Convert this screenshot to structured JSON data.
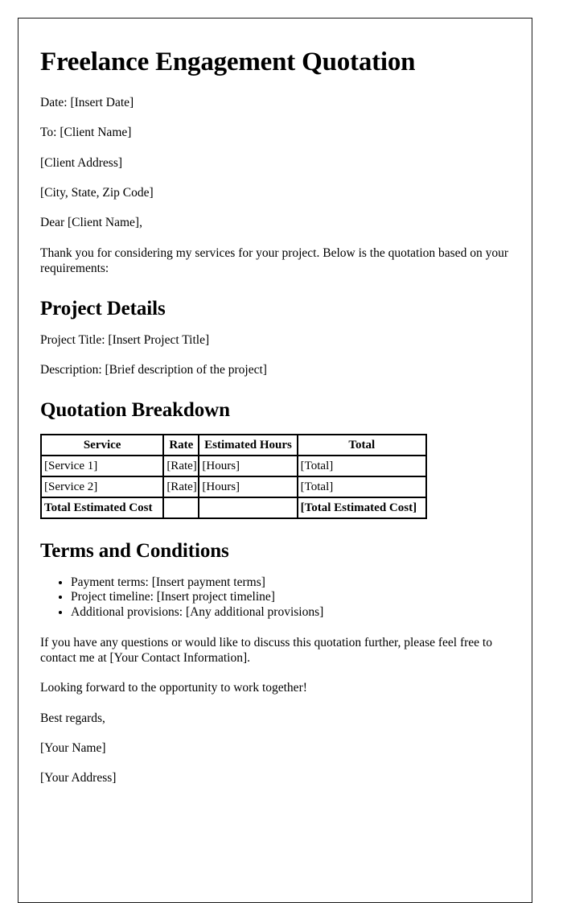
{
  "document": {
    "title": "Freelance Engagement Quotation",
    "header_lines": [
      "Date: [Insert Date]",
      "To: [Client Name]",
      "[Client Address]",
      "[City, State, Zip Code]",
      "Dear [Client Name],"
    ],
    "intro_paragraph": "Thank you for considering my services for your project. Below is the quotation based on your requirements:",
    "sections": {
      "project_details": {
        "heading": "Project Details",
        "project_title_line": "Project Title: [Insert Project Title]",
        "description_line": "Description: [Brief description of the project]"
      },
      "quotation_breakdown": {
        "heading": "Quotation Breakdown",
        "table": {
          "columns": [
            "Service",
            "Rate",
            "Estimated Hours",
            "Total"
          ],
          "rows": [
            [
              "[Service 1]",
              "[Rate]",
              "[Hours]",
              "[Total]"
            ],
            [
              "[Service 2]",
              "[Rate]",
              "[Hours]",
              "[Total]"
            ],
            [
              "Total Estimated Cost",
              "",
              "",
              "[Total Estimated Cost]"
            ]
          ]
        }
      },
      "terms_and_conditions": {
        "heading": "Terms and Conditions",
        "items": [
          "Payment terms: [Insert payment terms]",
          "Project timeline: [Insert project timeline]",
          "Additional provisions: [Any additional provisions]"
        ]
      }
    },
    "closing": {
      "contact_paragraph": "If you have any questions or would like to discuss this quotation further, please feel free to contact me at [Your Contact Information].",
      "looking_forward": "Looking forward to the opportunity to work together!",
      "sign_off": "Best regards,",
      "signature_name": "[Your Name]",
      "signature_address": "[Your Address]"
    }
  }
}
